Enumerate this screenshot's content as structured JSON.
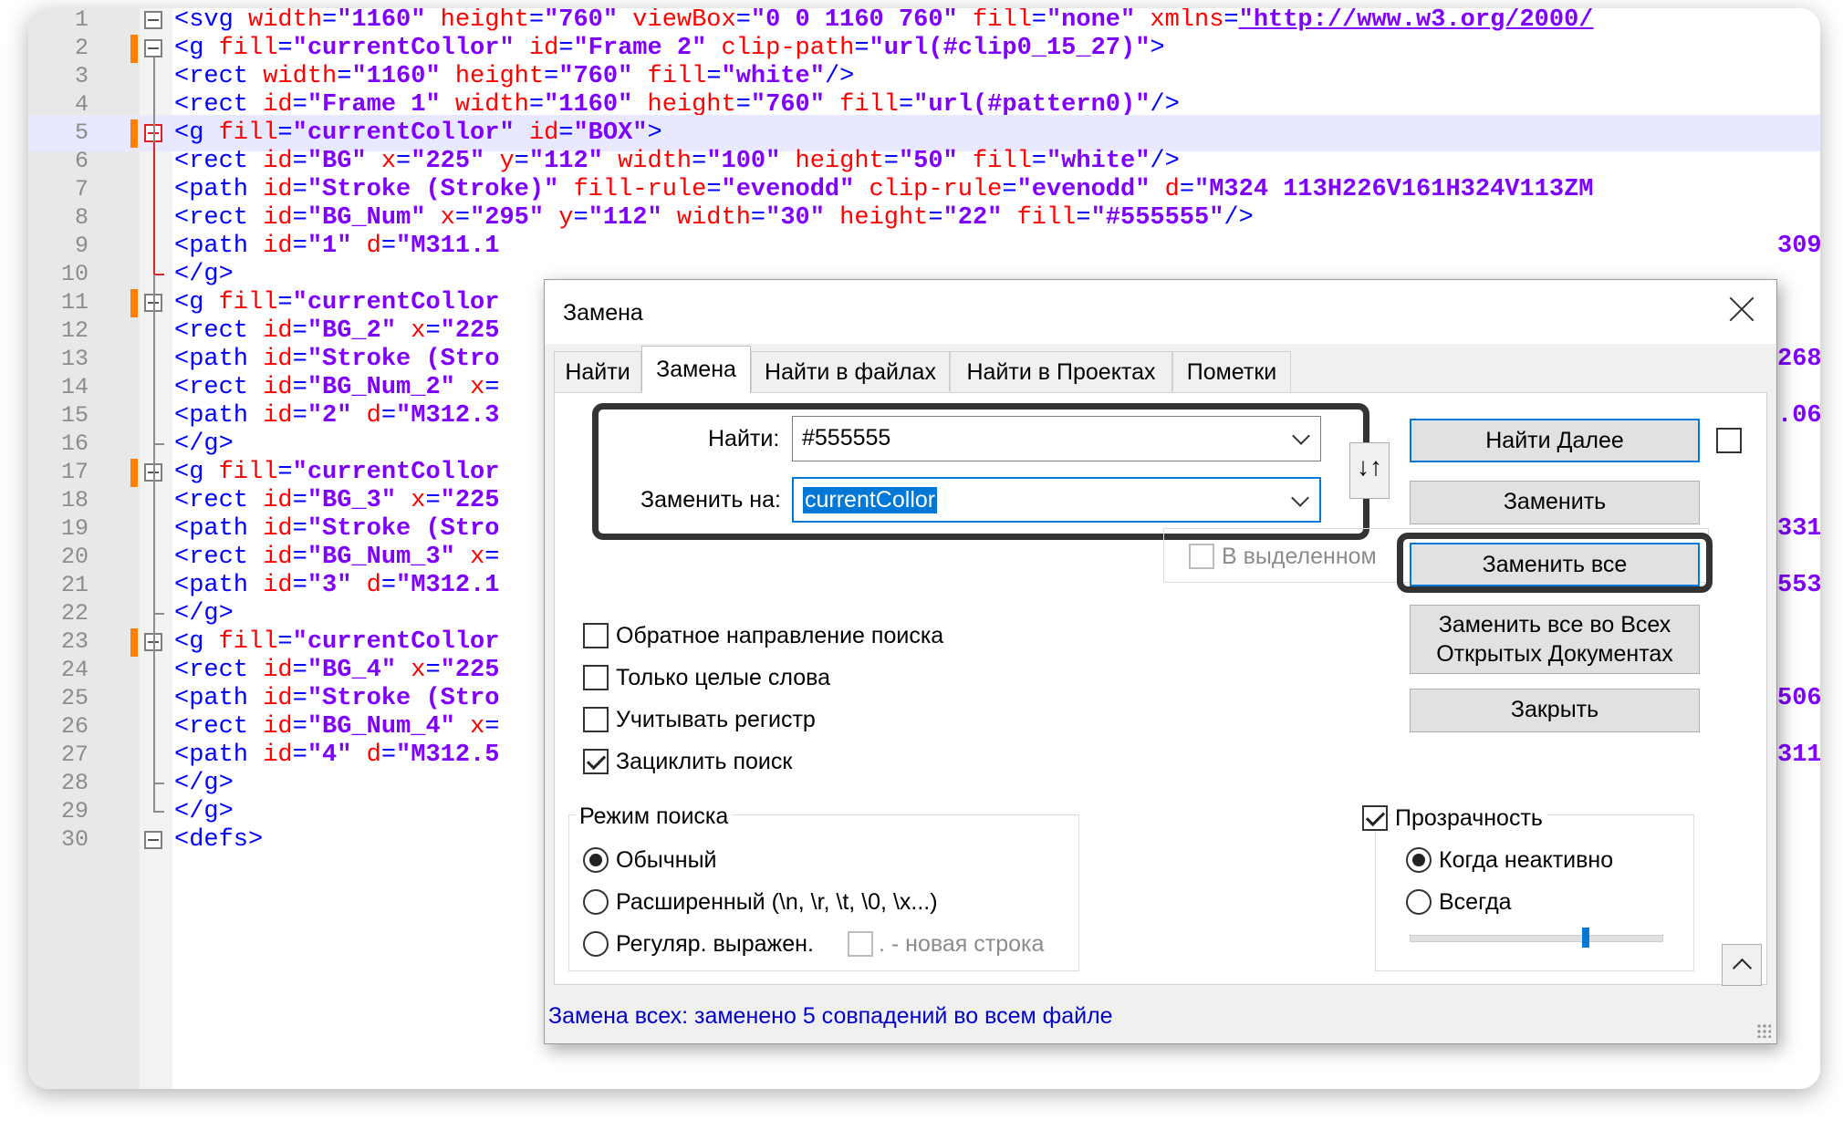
{
  "editor": {
    "lines": [
      {
        "n": "1",
        "tokens": [
          [
            "tag",
            "<svg "
          ],
          [
            "attr",
            "width"
          ],
          [
            "tag",
            "="
          ],
          [
            "val",
            "\"1160\""
          ],
          [
            "tag",
            " "
          ],
          [
            "attr",
            "height"
          ],
          [
            "tag",
            "="
          ],
          [
            "val",
            "\"760\""
          ],
          [
            "tag",
            " "
          ],
          [
            "attr",
            "viewBox"
          ],
          [
            "tag",
            "="
          ],
          [
            "val",
            "\"0 0 1160 760\""
          ],
          [
            "tag",
            " "
          ],
          [
            "attr",
            "fill"
          ],
          [
            "tag",
            "="
          ],
          [
            "val",
            "\"none\""
          ],
          [
            "tag",
            " "
          ],
          [
            "attr",
            "xmlns"
          ],
          [
            "tag",
            "="
          ],
          [
            "url",
            "\"http://www.w3.org/2000/"
          ]
        ]
      },
      {
        "n": "2",
        "tokens": [
          [
            "tag",
            "<g "
          ],
          [
            "attr",
            "fill"
          ],
          [
            "tag",
            "="
          ],
          [
            "val",
            "\"currentCollor\""
          ],
          [
            "tag",
            " "
          ],
          [
            "attr",
            "id"
          ],
          [
            "tag",
            "="
          ],
          [
            "val",
            "\"Frame 2\""
          ],
          [
            "tag",
            " "
          ],
          [
            "attr",
            "clip-path"
          ],
          [
            "tag",
            "="
          ],
          [
            "val",
            "\"url(#clip0_15_27)\""
          ],
          [
            "tag",
            ">"
          ]
        ]
      },
      {
        "n": "3",
        "tokens": [
          [
            "tag",
            "<rect "
          ],
          [
            "attr",
            "width"
          ],
          [
            "tag",
            "="
          ],
          [
            "val",
            "\"1160\""
          ],
          [
            "tag",
            " "
          ],
          [
            "attr",
            "height"
          ],
          [
            "tag",
            "="
          ],
          [
            "val",
            "\"760\""
          ],
          [
            "tag",
            " "
          ],
          [
            "attr",
            "fill"
          ],
          [
            "tag",
            "="
          ],
          [
            "val",
            "\"white\""
          ],
          [
            "tag",
            "/>"
          ]
        ]
      },
      {
        "n": "4",
        "tokens": [
          [
            "tag",
            "<rect "
          ],
          [
            "attr",
            "id"
          ],
          [
            "tag",
            "="
          ],
          [
            "val",
            "\"Frame 1\""
          ],
          [
            "tag",
            " "
          ],
          [
            "attr",
            "width"
          ],
          [
            "tag",
            "="
          ],
          [
            "val",
            "\"1160\""
          ],
          [
            "tag",
            " "
          ],
          [
            "attr",
            "height"
          ],
          [
            "tag",
            "="
          ],
          [
            "val",
            "\"760\""
          ],
          [
            "tag",
            " "
          ],
          [
            "attr",
            "fill"
          ],
          [
            "tag",
            "="
          ],
          [
            "val",
            "\"url(#pattern0)\""
          ],
          [
            "tag",
            "/>"
          ]
        ]
      },
      {
        "n": "5",
        "tokens": [
          [
            "tag",
            "<g "
          ],
          [
            "attr",
            "fill"
          ],
          [
            "tag",
            "="
          ],
          [
            "val",
            "\"currentCollor\""
          ],
          [
            "tag",
            " "
          ],
          [
            "attr",
            "id"
          ],
          [
            "tag",
            "="
          ],
          [
            "val",
            "\"BOX\""
          ],
          [
            "tag",
            ">"
          ]
        ]
      },
      {
        "n": "6",
        "tokens": [
          [
            "tag",
            "<rect "
          ],
          [
            "attr",
            "id"
          ],
          [
            "tag",
            "="
          ],
          [
            "val",
            "\"BG\""
          ],
          [
            "tag",
            " "
          ],
          [
            "attr",
            "x"
          ],
          [
            "tag",
            "="
          ],
          [
            "val",
            "\"225\""
          ],
          [
            "tag",
            " "
          ],
          [
            "attr",
            "y"
          ],
          [
            "tag",
            "="
          ],
          [
            "val",
            "\"112\""
          ],
          [
            "tag",
            " "
          ],
          [
            "attr",
            "width"
          ],
          [
            "tag",
            "="
          ],
          [
            "val",
            "\"100\""
          ],
          [
            "tag",
            " "
          ],
          [
            "attr",
            "height"
          ],
          [
            "tag",
            "="
          ],
          [
            "val",
            "\"50\""
          ],
          [
            "tag",
            " "
          ],
          [
            "attr",
            "fill"
          ],
          [
            "tag",
            "="
          ],
          [
            "val",
            "\"white\""
          ],
          [
            "tag",
            "/>"
          ]
        ]
      },
      {
        "n": "7",
        "tokens": [
          [
            "tag",
            "<path "
          ],
          [
            "attr",
            "id"
          ],
          [
            "tag",
            "="
          ],
          [
            "val",
            "\"Stroke (Stroke)\""
          ],
          [
            "tag",
            " "
          ],
          [
            "attr",
            "fill-rule"
          ],
          [
            "tag",
            "="
          ],
          [
            "val",
            "\"evenodd\""
          ],
          [
            "tag",
            " "
          ],
          [
            "attr",
            "clip-rule"
          ],
          [
            "tag",
            "="
          ],
          [
            "val",
            "\"evenodd\""
          ],
          [
            "tag",
            " "
          ],
          [
            "attr",
            "d"
          ],
          [
            "tag",
            "="
          ],
          [
            "val",
            "\"M324 113H226V161H324V113ZM"
          ]
        ]
      },
      {
        "n": "8",
        "tokens": [
          [
            "tag",
            "<rect "
          ],
          [
            "attr",
            "id"
          ],
          [
            "tag",
            "="
          ],
          [
            "val",
            "\"BG_Num\""
          ],
          [
            "tag",
            " "
          ],
          [
            "attr",
            "x"
          ],
          [
            "tag",
            "="
          ],
          [
            "val",
            "\"295\""
          ],
          [
            "tag",
            " "
          ],
          [
            "attr",
            "y"
          ],
          [
            "tag",
            "="
          ],
          [
            "val",
            "\"112\""
          ],
          [
            "tag",
            " "
          ],
          [
            "attr",
            "width"
          ],
          [
            "tag",
            "="
          ],
          [
            "val",
            "\"30\""
          ],
          [
            "tag",
            " "
          ],
          [
            "attr",
            "height"
          ],
          [
            "tag",
            "="
          ],
          [
            "val",
            "\"22\""
          ],
          [
            "tag",
            " "
          ],
          [
            "attr",
            "fill"
          ],
          [
            "tag",
            "="
          ],
          [
            "val",
            "\"#555555\""
          ],
          [
            "tag",
            "/>"
          ]
        ]
      },
      {
        "n": "9",
        "tokens": [
          [
            "tag",
            "<path "
          ],
          [
            "attr",
            "id"
          ],
          [
            "tag",
            "="
          ],
          [
            "val",
            "\"1\""
          ],
          [
            "tag",
            " "
          ],
          [
            "attr",
            "d"
          ],
          [
            "tag",
            "="
          ],
          [
            "val",
            "\"M311.1"
          ]
        ]
      },
      {
        "n": "10",
        "tokens": [
          [
            "tag",
            "</g>"
          ]
        ]
      },
      {
        "n": "11",
        "tokens": [
          [
            "tag",
            "<g "
          ],
          [
            "attr",
            "fill"
          ],
          [
            "tag",
            "="
          ],
          [
            "val",
            "\"currentCollor"
          ]
        ]
      },
      {
        "n": "12",
        "tokens": [
          [
            "tag",
            "<rect "
          ],
          [
            "attr",
            "id"
          ],
          [
            "tag",
            "="
          ],
          [
            "val",
            "\"BG_2\""
          ],
          [
            "tag",
            " "
          ],
          [
            "attr",
            "x"
          ],
          [
            "tag",
            "="
          ],
          [
            "val",
            "\"225"
          ]
        ]
      },
      {
        "n": "13",
        "tokens": [
          [
            "tag",
            "<path "
          ],
          [
            "attr",
            "id"
          ],
          [
            "tag",
            "="
          ],
          [
            "val",
            "\"Stroke (Stro"
          ]
        ]
      },
      {
        "n": "14",
        "tokens": [
          [
            "tag",
            "<rect "
          ],
          [
            "attr",
            "id"
          ],
          [
            "tag",
            "="
          ],
          [
            "val",
            "\"BG_Num_2\""
          ],
          [
            "tag",
            " "
          ],
          [
            "attr",
            "x"
          ],
          [
            "tag",
            "="
          ]
        ]
      },
      {
        "n": "15",
        "tokens": [
          [
            "tag",
            "<path "
          ],
          [
            "attr",
            "id"
          ],
          [
            "tag",
            "="
          ],
          [
            "val",
            "\"2\""
          ],
          [
            "tag",
            " "
          ],
          [
            "attr",
            "d"
          ],
          [
            "tag",
            "="
          ],
          [
            "val",
            "\"M312.3"
          ]
        ]
      },
      {
        "n": "16",
        "tokens": [
          [
            "tag",
            "</g>"
          ]
        ]
      },
      {
        "n": "17",
        "tokens": [
          [
            "tag",
            "<g "
          ],
          [
            "attr",
            "fill"
          ],
          [
            "tag",
            "="
          ],
          [
            "val",
            "\"currentCollor"
          ]
        ]
      },
      {
        "n": "18",
        "tokens": [
          [
            "tag",
            "<rect "
          ],
          [
            "attr",
            "id"
          ],
          [
            "tag",
            "="
          ],
          [
            "val",
            "\"BG_3\""
          ],
          [
            "tag",
            " "
          ],
          [
            "attr",
            "x"
          ],
          [
            "tag",
            "="
          ],
          [
            "val",
            "\"225"
          ]
        ]
      },
      {
        "n": "19",
        "tokens": [
          [
            "tag",
            "<path "
          ],
          [
            "attr",
            "id"
          ],
          [
            "tag",
            "="
          ],
          [
            "val",
            "\"Stroke (Stro"
          ]
        ]
      },
      {
        "n": "20",
        "tokens": [
          [
            "tag",
            "<rect "
          ],
          [
            "attr",
            "id"
          ],
          [
            "tag",
            "="
          ],
          [
            "val",
            "\"BG_Num_3\""
          ],
          [
            "tag",
            " "
          ],
          [
            "attr",
            "x"
          ],
          [
            "tag",
            "="
          ]
        ]
      },
      {
        "n": "21",
        "tokens": [
          [
            "tag",
            "<path "
          ],
          [
            "attr",
            "id"
          ],
          [
            "tag",
            "="
          ],
          [
            "val",
            "\"3\""
          ],
          [
            "tag",
            " "
          ],
          [
            "attr",
            "d"
          ],
          [
            "tag",
            "="
          ],
          [
            "val",
            "\"M312.1"
          ]
        ]
      },
      {
        "n": "22",
        "tokens": [
          [
            "tag",
            "</g>"
          ]
        ]
      },
      {
        "n": "23",
        "tokens": [
          [
            "tag",
            "<g "
          ],
          [
            "attr",
            "fill"
          ],
          [
            "tag",
            "="
          ],
          [
            "val",
            "\"currentCollor"
          ]
        ]
      },
      {
        "n": "24",
        "tokens": [
          [
            "tag",
            "<rect "
          ],
          [
            "attr",
            "id"
          ],
          [
            "tag",
            "="
          ],
          [
            "val",
            "\"BG_4\""
          ],
          [
            "tag",
            " "
          ],
          [
            "attr",
            "x"
          ],
          [
            "tag",
            "="
          ],
          [
            "val",
            "\"225"
          ]
        ]
      },
      {
        "n": "25",
        "tokens": [
          [
            "tag",
            "<path "
          ],
          [
            "attr",
            "id"
          ],
          [
            "tag",
            "="
          ],
          [
            "val",
            "\"Stroke (Stro"
          ]
        ]
      },
      {
        "n": "26",
        "tokens": [
          [
            "tag",
            "<rect "
          ],
          [
            "attr",
            "id"
          ],
          [
            "tag",
            "="
          ],
          [
            "val",
            "\"BG_Num_4\""
          ],
          [
            "tag",
            " "
          ],
          [
            "attr",
            "x"
          ],
          [
            "tag",
            "="
          ]
        ]
      },
      {
        "n": "27",
        "tokens": [
          [
            "tag",
            "<path "
          ],
          [
            "attr",
            "id"
          ],
          [
            "tag",
            "="
          ],
          [
            "val",
            "\"4\""
          ],
          [
            "tag",
            " "
          ],
          [
            "attr",
            "d"
          ],
          [
            "tag",
            "="
          ],
          [
            "val",
            "\"M312.5"
          ]
        ]
      },
      {
        "n": "28",
        "tokens": [
          [
            "tag",
            "</g>"
          ]
        ]
      },
      {
        "n": "29",
        "tokens": [
          [
            "tag",
            "</g>"
          ]
        ]
      },
      {
        "n": "30",
        "tokens": [
          [
            "tag",
            "<defs>"
          ]
        ]
      }
    ],
    "right_fragments": [
      {
        "line": "9",
        "text": "309"
      },
      {
        "line": "13",
        "text": "268"
      },
      {
        "line": "15",
        "text": ".06"
      },
      {
        "line": "19",
        "text": "331"
      },
      {
        "line": "21",
        "text": "553"
      },
      {
        "line": "25",
        "text": "506"
      },
      {
        "line": "27",
        "text": "311"
      }
    ]
  },
  "dialog": {
    "title": "Замена",
    "tabs": [
      "Найти",
      "Замена",
      "Найти в файлах",
      "Найти в Проектах",
      "Пометки"
    ],
    "active_tab": "Замена",
    "find_label": "Найти:",
    "find_value": "#555555",
    "replace_label": "Заменить на:",
    "replace_value": "currentCollor",
    "in_selection_label": "В выделенном",
    "buttons": {
      "find_next": "Найти Далее",
      "replace": "Заменить",
      "replace_all": "Заменить все",
      "replace_all_docs_1": "Заменить все во Всех",
      "replace_all_docs_2": "Открытых Документах",
      "close": "Закрыть"
    },
    "options": [
      {
        "label": "Обратное направление поиска",
        "checked": false
      },
      {
        "label": "Только целые слова",
        "checked": false
      },
      {
        "label": "Учитывать регистр",
        "checked": false
      },
      {
        "label": "Зациклить поиск",
        "checked": true
      }
    ],
    "search_mode": {
      "title": "Режим поиска",
      "options": [
        "Обычный",
        "Расширенный (\\n, \\r, \\t, \\0, \\x...)",
        "Регуляр. выражен."
      ],
      "selected": "Обычный",
      "newline_label": ". - новая строка"
    },
    "transparency": {
      "title": "Прозрачность",
      "checked": true,
      "options": [
        "Когда неактивно",
        "Всегда"
      ],
      "selected": "Когда неактивно",
      "level": 0.7
    },
    "swap_icon": "swap-arrows-icon",
    "status": "Замена всех: заменено 5 совпадений во всем файле"
  }
}
